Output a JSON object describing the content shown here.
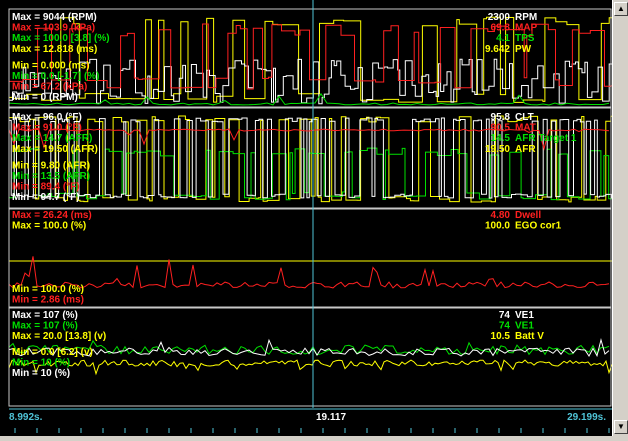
{
  "colors": {
    "white": "#ffffff",
    "red": "#ff2020",
    "green": "#00e000",
    "yellow": "#ffff00",
    "cursor": "#4fc3d6",
    "bg": "#000000"
  },
  "cursor_time": "19.117",
  "chart_data": [
    {
      "type": "line",
      "left_labels": [
        {
          "text": "Max = 9044 (RPM)",
          "color": "white"
        },
        {
          "text": "Max = 103.9 (kPa)",
          "color": "red"
        },
        {
          "text": "Max = 100.0 [3.8] (%)",
          "color": "green"
        },
        {
          "text": "Max = 12.818 (ms)",
          "color": "yellow"
        },
        {
          "text": "Min = 0.000 (ms)",
          "color": "yellow"
        },
        {
          "text": "Min = 0.0 [-1.7] (%)",
          "color": "green"
        },
        {
          "text": "Min = 67.2 (kPa)",
          "color": "red"
        },
        {
          "text": "Min = 0 (RPM)",
          "color": "white"
        }
      ],
      "series": [
        {
          "name": "RPM",
          "value": "2300",
          "color": "white"
        },
        {
          "name": "MAP",
          "value": "69.8",
          "color": "red"
        },
        {
          "name": "TPS",
          "value": "4.1",
          "color": "green"
        },
        {
          "name": "PW",
          "value": "9.642",
          "color": "yellow"
        }
      ]
    },
    {
      "type": "line",
      "left_labels": [
        {
          "text": "Max = 96.0 (°F)",
          "color": "white"
        },
        {
          "text": "Max = 91.0 (°F)",
          "color": "red"
        },
        {
          "text": "Max = 14.7 (AFR)",
          "color": "green"
        },
        {
          "text": "Max = 19.50 (AFR)",
          "color": "yellow"
        },
        {
          "text": "Min = 9.80 (AFR)",
          "color": "yellow"
        },
        {
          "text": "Min = 13.5 (AFR)",
          "color": "green"
        },
        {
          "text": "Min = 89.4 (°F)",
          "color": "red"
        },
        {
          "text": "Min = 94.7 (°F)",
          "color": "white"
        }
      ],
      "series": [
        {
          "name": "CLT",
          "value": "95.8",
          "color": "white"
        },
        {
          "name": "MAT",
          "value": "90.5",
          "color": "red"
        },
        {
          "name": "AFR Target 1",
          "value": "14.5",
          "color": "green"
        },
        {
          "name": "AFR",
          "value": "19.50",
          "color": "yellow"
        }
      ]
    },
    {
      "type": "line",
      "left_labels": [
        {
          "text": "Max = 26.24 (ms)",
          "color": "red"
        },
        {
          "text": "Max = 100.0 (%)",
          "color": "yellow"
        },
        {
          "text": "Min = 100.0 (%)",
          "color": "yellow"
        },
        {
          "text": "Min = 2.86 (ms)",
          "color": "red"
        }
      ],
      "series": [
        {
          "name": "Dwell",
          "value": "4.80",
          "color": "red"
        },
        {
          "name": "EGO cor1",
          "value": "100.0",
          "color": "yellow"
        }
      ]
    },
    {
      "type": "line",
      "left_labels": [
        {
          "text": "Max = 107 (%)",
          "color": "white"
        },
        {
          "text": "Max = 107 (%)",
          "color": "green"
        },
        {
          "text": "Max = 20.0 [13.8] (v)",
          "color": "yellow"
        },
        {
          "text": "Min = 0.0 [6.2] (v)",
          "color": "yellow"
        },
        {
          "text": "Min = 10 (%)",
          "color": "green"
        },
        {
          "text": "Min = 10 (%)",
          "color": "white"
        }
      ],
      "series": [
        {
          "name": "VE1",
          "value": "74",
          "color": "white"
        },
        {
          "name": "VE1",
          "value": "74",
          "color": "green"
        },
        {
          "name": "Batt V",
          "value": "10.5",
          "color": "yellow"
        }
      ]
    }
  ],
  "time_axis": {
    "start": "8.992s.",
    "end": "29.199s."
  }
}
